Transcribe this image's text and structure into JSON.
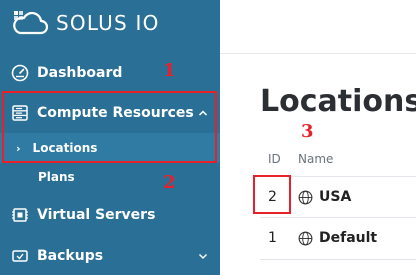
{
  "brand": {
    "name": "SOLUS IO"
  },
  "sidebar": {
    "items": [
      {
        "label": "Dashboard",
        "icon": "gauge-icon"
      },
      {
        "label": "Compute Resources",
        "icon": "server-list-icon",
        "chevron": "chevron-up-icon"
      },
      {
        "label": "Virtual Servers",
        "icon": "virtual-servers-icon"
      },
      {
        "label": "Backups",
        "icon": "backup-drive-icon",
        "chevron": "chevron-down-icon"
      }
    ],
    "submenu": [
      {
        "label": "Locations",
        "marker": "›",
        "active": true
      },
      {
        "label": "Plans",
        "active": false
      }
    ]
  },
  "annotations": {
    "one": "1",
    "two": "2",
    "three": "3",
    "color": "#e8202a"
  },
  "main": {
    "title": "Locations",
    "table": {
      "headers": [
        "ID",
        "Name"
      ],
      "rows": [
        {
          "id": "2",
          "name": "USA",
          "icon": "globe-icon"
        },
        {
          "id": "1",
          "name": "Default",
          "icon": "globe-icon"
        }
      ]
    }
  },
  "colors": {
    "sidebar": "#2a6f95",
    "sidebar_active": "#2f7ba3",
    "text_dark": "#2b2f33"
  }
}
